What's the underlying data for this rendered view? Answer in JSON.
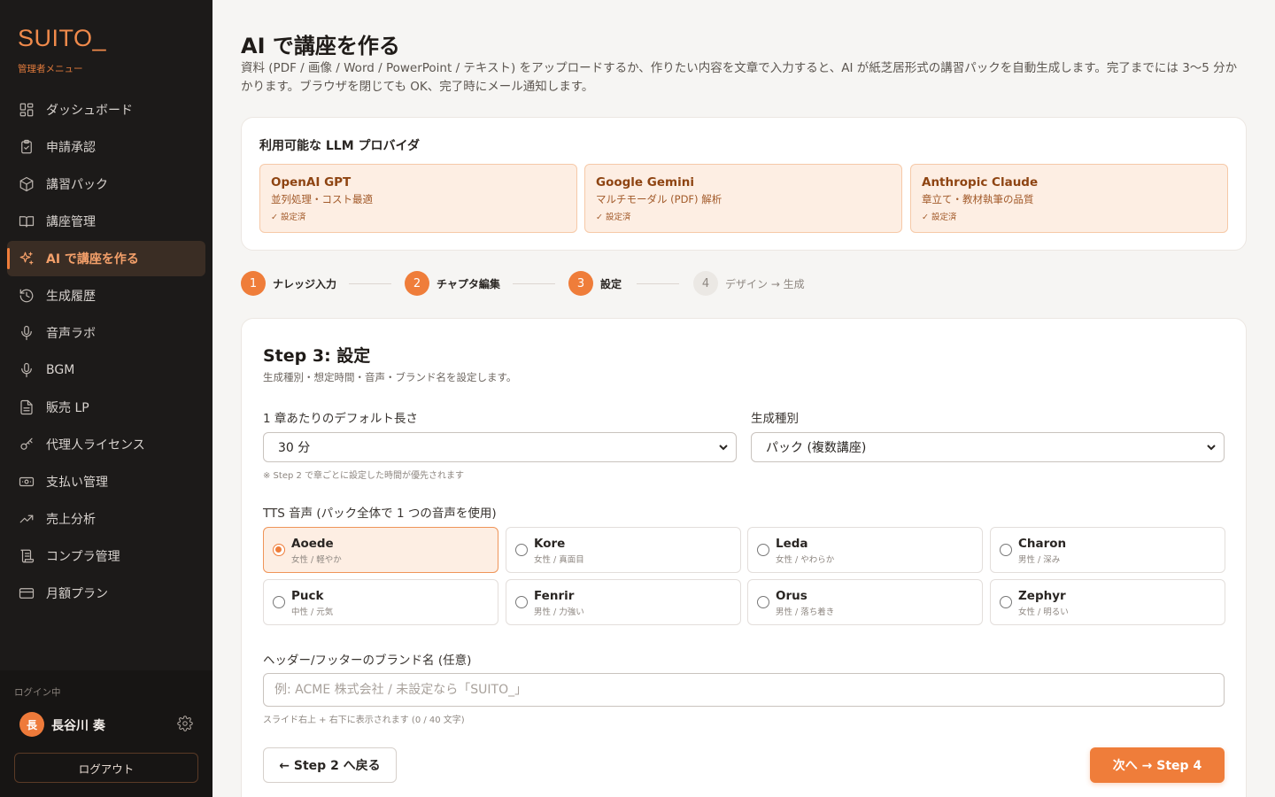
{
  "sidebar": {
    "brand": "SUITO_",
    "subtitle": "管理者メニュー",
    "items": [
      {
        "label": "ダッシュボード",
        "icon": "dashboard-icon"
      },
      {
        "label": "申請承認",
        "icon": "clipboard-icon"
      },
      {
        "label": "講習パック",
        "icon": "package-icon"
      },
      {
        "label": "講座管理",
        "icon": "book-icon"
      },
      {
        "label": "AI で講座を作る",
        "icon": "sparkles-icon",
        "active": true
      },
      {
        "label": "生成履歴",
        "icon": "history-icon"
      },
      {
        "label": "音声ラボ",
        "icon": "microphone-icon"
      },
      {
        "label": "BGM",
        "icon": "microphone-icon"
      },
      {
        "label": "販売 LP",
        "icon": "document-icon"
      },
      {
        "label": "代理人ライセンス",
        "icon": "key-icon"
      },
      {
        "label": "支払い管理",
        "icon": "money-icon"
      },
      {
        "label": "売上分析",
        "icon": "trend-icon"
      },
      {
        "label": "コンプラ管理",
        "icon": "scroll-icon"
      },
      {
        "label": "月額プラン",
        "icon": "card-icon"
      }
    ],
    "login_label": "ログイン中",
    "user_initial": "長",
    "user_name": "長谷川 奏",
    "logout_label": "ログアウト"
  },
  "header": {
    "title": "AI で講座を作る",
    "description": "資料 (PDF / 画像 / Word / PowerPoint / テキスト) をアップロードするか、作りたい内容を文章で入力すると、AI が紙芝居形式の講習パックを自動生成します。完了までには 3〜5 分かかります。ブラウザを閉じても OK、完了時にメール通知します。"
  },
  "llm": {
    "title": "利用可能な LLM プロバイダ",
    "providers": [
      {
        "name": "OpenAI GPT",
        "desc": "並列処理・コスト最適",
        "status": "✓ 設定済"
      },
      {
        "name": "Google Gemini",
        "desc": "マルチモーダル (PDF) 解析",
        "status": "✓ 設定済"
      },
      {
        "name": "Anthropic Claude",
        "desc": "章立て・教材執筆の品質",
        "status": "✓ 設定済"
      }
    ]
  },
  "stepper": {
    "steps": [
      {
        "num": "1",
        "label": "ナレッジ入力",
        "done": true
      },
      {
        "num": "2",
        "label": "チャプタ編集",
        "done": true
      },
      {
        "num": "3",
        "label": "設定",
        "done": true
      },
      {
        "num": "4",
        "label": "デザイン → 生成",
        "done": false
      }
    ]
  },
  "form": {
    "title": "Step 3: 設定",
    "subtitle": "生成種別・想定時間・音声・ブランド名を設定します。",
    "length_label": "1 章あたりのデフォルト長さ",
    "length_value": "30 分",
    "length_hint": "※ Step 2 で章ごとに設定した時間が優先されます",
    "type_label": "生成種別",
    "type_value": "パック (複数講座)",
    "tts_label": "TTS 音声 (パック全体で 1 つの音声を使用)",
    "voices": [
      {
        "name": "Aoede",
        "desc": "女性 / 軽やか",
        "selected": true
      },
      {
        "name": "Kore",
        "desc": "女性 / 真面目"
      },
      {
        "name": "Leda",
        "desc": "女性 / やわらか"
      },
      {
        "name": "Charon",
        "desc": "男性 / 深み"
      },
      {
        "name": "Puck",
        "desc": "中性 / 元気"
      },
      {
        "name": "Fenrir",
        "desc": "男性 / 力強い"
      },
      {
        "name": "Orus",
        "desc": "男性 / 落ち着き"
      },
      {
        "name": "Zephyr",
        "desc": "女性 / 明るい"
      }
    ],
    "brand_label": "ヘッダー/フッターのブランド名 (任意)",
    "brand_placeholder": "例: ACME 株式会社 / 未設定なら「SUITO_」",
    "brand_value": "",
    "brand_hint": "スライド右上 + 右下に表示されます (0 / 40 文字)",
    "back_label": "← Step 2 へ戻る",
    "next_label": "次へ → Step 4"
  },
  "colors": {
    "accent": "#ef7d3a",
    "sidebar_bg": "#1c1a19",
    "provider_bg": "#fdeee3"
  }
}
